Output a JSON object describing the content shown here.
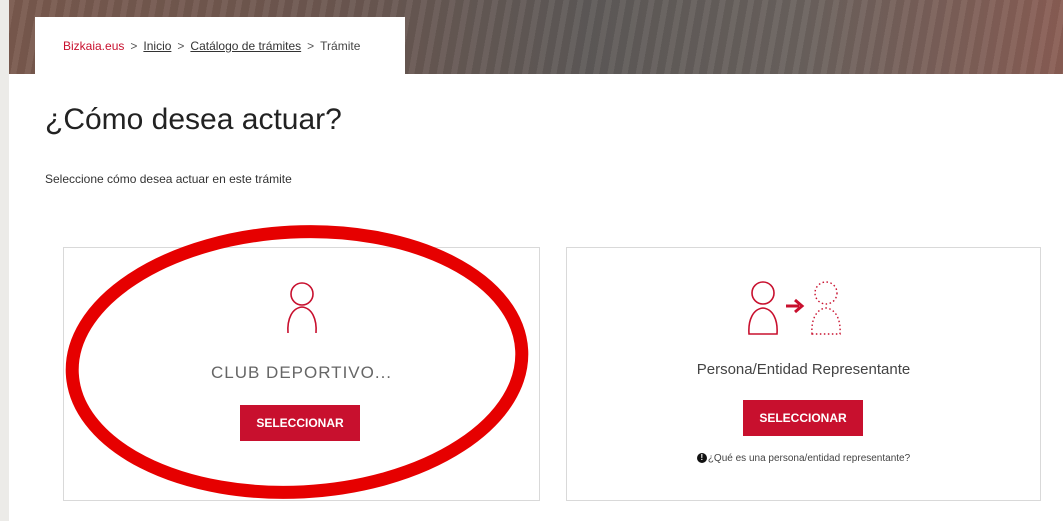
{
  "breadcrumb": {
    "home": "Bizkaia.eus",
    "sep": ">",
    "inicio": "Inicio",
    "catalogo": "Catálogo de trámites",
    "current": "Trámite"
  },
  "page": {
    "title": "¿Cómo desea actuar?",
    "subtitle": "Seleccione cómo desea actuar en este trámite"
  },
  "options": [
    {
      "label": "CLUB DEPORTIVO...",
      "button": "SELECCIONAR"
    },
    {
      "label": "Persona/Entidad Representante",
      "button": "SELECCIONAR",
      "help": "¿Qué es una persona/entidad representante?"
    }
  ],
  "colors": {
    "accent": "#c8102e",
    "annotation": "#e60000"
  },
  "icons": {
    "info": "!",
    "person": "person-icon",
    "representative": "representative-icon"
  }
}
